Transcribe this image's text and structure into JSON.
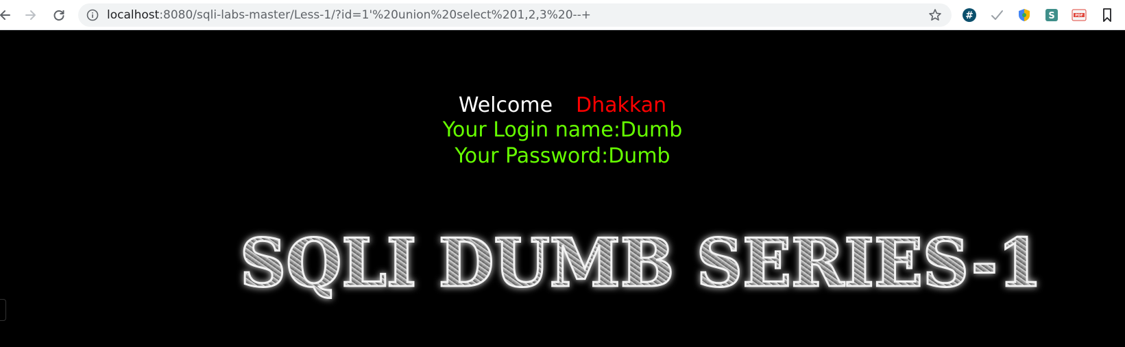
{
  "browser": {
    "url_host": "localhost",
    "url_rest": ":8080/sqli-labs-master/Less-1/?id=1'%20union%20select%201,2,3%20--+",
    "icons": {
      "back": "back-arrow-icon",
      "forward": "forward-arrow-icon",
      "reload": "reload-icon",
      "site_info": "info-icon",
      "bookmark": "star-icon"
    },
    "extensions": [
      {
        "name": "hash-extension-icon",
        "glyph": "#",
        "color": "#0a4a6e"
      },
      {
        "name": "check-extension-icon",
        "glyph": "✓",
        "color": "#9aa0a6"
      },
      {
        "name": "shield-extension-icon",
        "glyph": "",
        "color": "#f4b400"
      },
      {
        "name": "s-extension-icon",
        "glyph": "S",
        "color": "#3f8f8a"
      },
      {
        "name": "pdf-extension-icon",
        "glyph": "PDF",
        "color": "#e0453a"
      },
      {
        "name": "bookmark-extension-icon",
        "glyph": "",
        "color": "#5f6368"
      }
    ]
  },
  "page": {
    "welcome_label": "Welcome",
    "welcome_name": "Dhakkan",
    "login_line": "Your Login name:Dumb",
    "password_line": "Your Password:Dumb",
    "banner_text": "SQLI DUMB SERIES-1",
    "colors": {
      "background": "#000000",
      "welcome": "#ffffff",
      "name": "#ff0000",
      "info": "#66ff00"
    }
  }
}
